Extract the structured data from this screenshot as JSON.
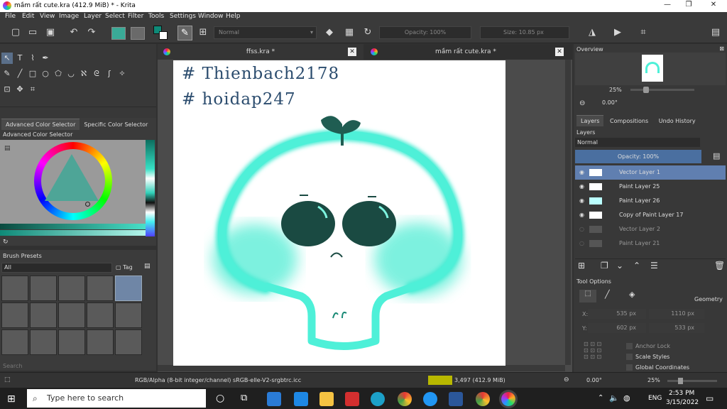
{
  "window": {
    "title": "mầm rất cute.kra (412.9 MiB)  * - Krita",
    "minimize": "—",
    "maximize": "❐",
    "close": "✕"
  },
  "menu": [
    "File",
    "Edit",
    "View",
    "Image",
    "Layer",
    "Select",
    "Filter",
    "Tools",
    "Settings",
    "Window",
    "Help"
  ],
  "toolbar": {
    "blend_mode": "Normal",
    "opacity": "Opacity: 100%",
    "size": "Size: 10.85 px"
  },
  "docs": [
    {
      "name": "ffss.kra *"
    },
    {
      "name": "mầm rất cute.kra *"
    }
  ],
  "color_tabs": {
    "advanced": "Advanced Color Selector",
    "specific": "Specific Color Selector",
    "panel_title": "Advanced Color Selector"
  },
  "brush_presets": {
    "title": "Brush Presets",
    "filter": "All",
    "tag": "Tag",
    "search_placeholder": "Search"
  },
  "canvas_text": {
    "line1": "# Thienbach2178",
    "line2": "# hoidap247"
  },
  "overview": {
    "title": "Overview",
    "zoom": "25%",
    "rotation": "0.00°"
  },
  "right_tabs": {
    "layers": "Layers",
    "compositions": "Compositions",
    "undo": "Undo History"
  },
  "layers": {
    "title": "Layers",
    "blend": "Normal",
    "opacity": "Opacity:  100%",
    "items": [
      {
        "name": "Vector Layer 1",
        "selected": true,
        "visible": true
      },
      {
        "name": "Paint Layer 25",
        "selected": false,
        "visible": true
      },
      {
        "name": "Paint Layer 26",
        "selected": false,
        "visible": true
      },
      {
        "name": "Copy of Paint Layer 17",
        "selected": false,
        "visible": true
      },
      {
        "name": "Vector Layer 2",
        "selected": false,
        "visible": false
      },
      {
        "name": "Paint Layer 21",
        "selected": false,
        "visible": false
      }
    ]
  },
  "tool_options": {
    "title": "Tool Options",
    "geometry": "Geometry",
    "x_label": "X:",
    "y_label": "Y:",
    "x": "535 px",
    "y": "602 px",
    "w": "1110 px",
    "h": "533 px",
    "anchor": "Anchor Lock",
    "scale": "Scale Styles",
    "global": "Global Coordinates"
  },
  "status": {
    "color_info": "RGB/Alpha (8-bit integer/channel)  sRGB-elle-V2-srgbtrc.icc",
    "size": "3,497 (412.9 MiB)",
    "rotation": "0.00°",
    "zoom": "25%"
  },
  "taskbar": {
    "search": "Type here to search",
    "time": "2:53 PM",
    "date": "3/15/2022",
    "lang": "ENG"
  },
  "colors": {
    "accent": "#4a6fa0",
    "mint": "#3de8cf",
    "dark_green": "#1a4a42",
    "highlight": "#607fb0"
  }
}
